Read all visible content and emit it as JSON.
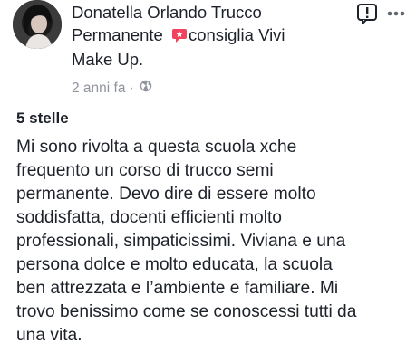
{
  "post": {
    "author_name": "Donatella Orlando Trucco Permanente",
    "recommendation_icon": "recommend-speech-icon",
    "recommends_text": "consiglia",
    "page_name": "Vivi Make Up.",
    "header_lines": [
      "Donatella Orlando Trucco",
      "Permanente",
      "consiglia Vivi",
      "Make Up."
    ],
    "time_ago": "2 anni fa",
    "separator": "·",
    "privacy_icon": "globe-icon",
    "actions": {
      "report_icon": "report-flag-icon",
      "more_icon": "more-dots-icon"
    },
    "rating": "5 stelle",
    "review_lines": [
      "Mi sono rivolta a questa scuola xche",
      "frequento un corso di trucco semi",
      "permanente. Devo dire di essere molto",
      "soddisfatta, docenti efficienti molto",
      "professionali, simpaticissimi. Viviana e una",
      "persona dolce e molto educata, la scuola",
      "ben attrezzata e l’ambiente e familiare. Mi",
      "trovo benissimo come se conoscessi tutti da",
      "una vita."
    ],
    "colors": {
      "text": "#1d2129",
      "meta": "#90949c",
      "recommend_red": "#f3425f"
    }
  }
}
